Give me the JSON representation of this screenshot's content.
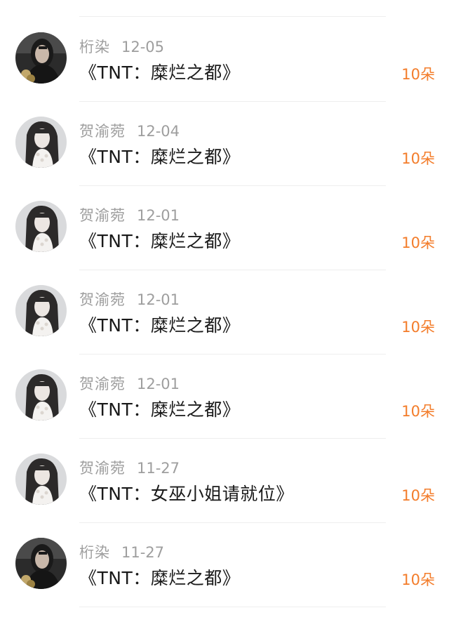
{
  "gifts": [
    {
      "user": "桁染",
      "date": "12-05",
      "title": "《TNT：糜烂之都》",
      "amount": "10朵",
      "avatar": "avatar-dark-portrait"
    },
    {
      "user": "贺渝菀",
      "date": "12-04",
      "title": "《TNT：糜烂之都》",
      "amount": "10朵",
      "avatar": "avatar-girl-portrait"
    },
    {
      "user": "贺渝菀",
      "date": "12-01",
      "title": "《TNT：糜烂之都》",
      "amount": "10朵",
      "avatar": "avatar-girl-portrait"
    },
    {
      "user": "贺渝菀",
      "date": "12-01",
      "title": "《TNT：糜烂之都》",
      "amount": "10朵",
      "avatar": "avatar-girl-portrait"
    },
    {
      "user": "贺渝菀",
      "date": "12-01",
      "title": "《TNT：糜烂之都》",
      "amount": "10朵",
      "avatar": "avatar-girl-portrait"
    },
    {
      "user": "贺渝菀",
      "date": "11-27",
      "title": "《TNT：女巫小姐请就位》",
      "amount": "10朵",
      "avatar": "avatar-girl-portrait"
    },
    {
      "user": "桁染",
      "date": "11-27",
      "title": "《TNT：糜烂之都》",
      "amount": "10朵",
      "avatar": "avatar-dark-portrait"
    }
  ],
  "colors": {
    "amount": "#f37c2a",
    "meta": "#9e9e9e",
    "title": "#1a1a1a",
    "divider": "#eeeeee"
  }
}
